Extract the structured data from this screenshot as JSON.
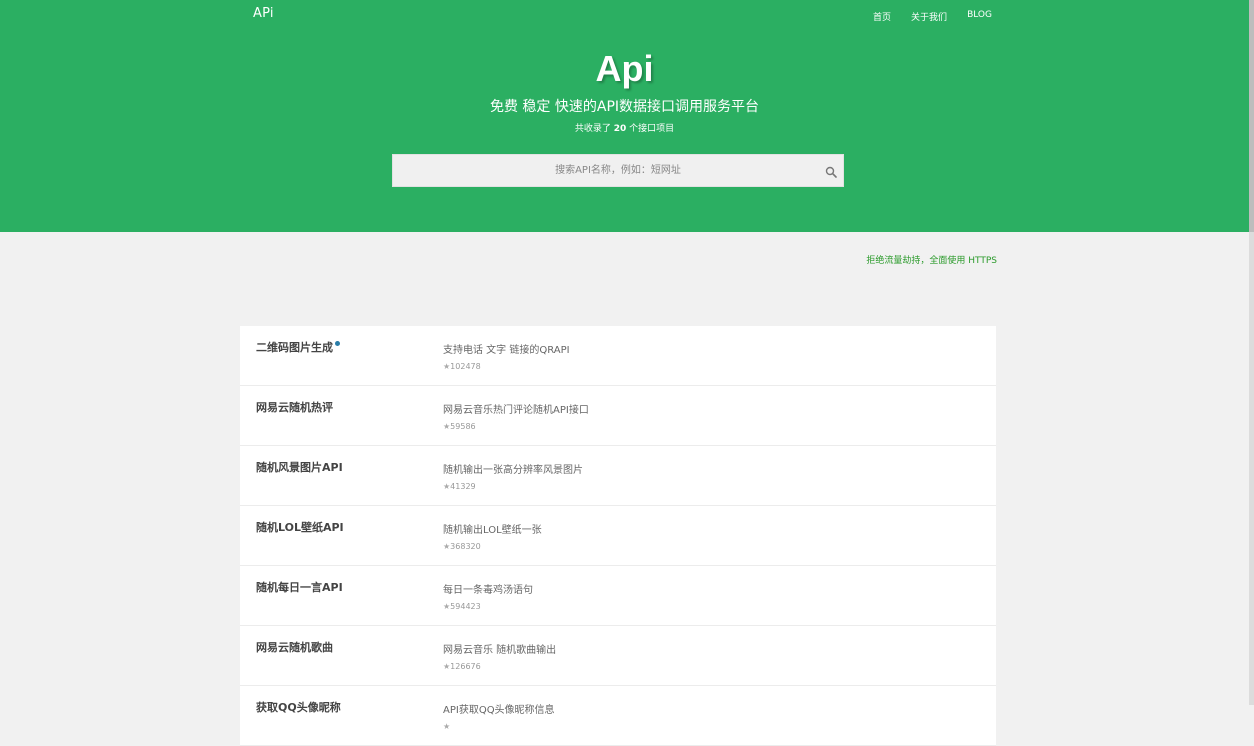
{
  "nav": {
    "logo": "APi",
    "links": [
      {
        "label": "首页"
      },
      {
        "label": "关于我们"
      },
      {
        "label": "BLOG"
      }
    ]
  },
  "hero": {
    "title": "Api",
    "subtitle": "免费 稳定 快速的API数据接口调用服务平台",
    "count_prefix": "共收录了",
    "count_value": "20",
    "count_suffix": "个接口项目"
  },
  "search": {
    "placeholder": "搜索API名称，例如：短网址",
    "icon": "search-icon"
  },
  "https_note": "拒绝流量劫持，全面使用 HTTPS",
  "colors": {
    "brand": "#2baf62",
    "dot": "#2a7da8",
    "note": "#2a9a2a"
  },
  "apis": [
    {
      "name": "二维码图片生成",
      "badge": true,
      "desc": "支持电话 文字 链接的QRAPI",
      "stars": "102478"
    },
    {
      "name": "网易云随机热评",
      "badge": false,
      "desc": "网易云音乐热门评论随机API接口",
      "stars": "59586"
    },
    {
      "name": "随机风景图片API",
      "badge": false,
      "desc": "随机输出一张高分辨率风景图片",
      "stars": "41329"
    },
    {
      "name": "随机LOL壁纸API",
      "badge": false,
      "desc": "随机输出LOL壁纸一张",
      "stars": "368320"
    },
    {
      "name": "随机每日一言API",
      "badge": false,
      "desc": "每日一条毒鸡汤语句",
      "stars": "594423"
    },
    {
      "name": "网易云随机歌曲",
      "badge": false,
      "desc": "网易云音乐 随机歌曲输出",
      "stars": "126676"
    },
    {
      "name": "获取QQ头像昵称",
      "badge": false,
      "desc": "API获取QQ头像昵称信息",
      "stars": ""
    }
  ]
}
